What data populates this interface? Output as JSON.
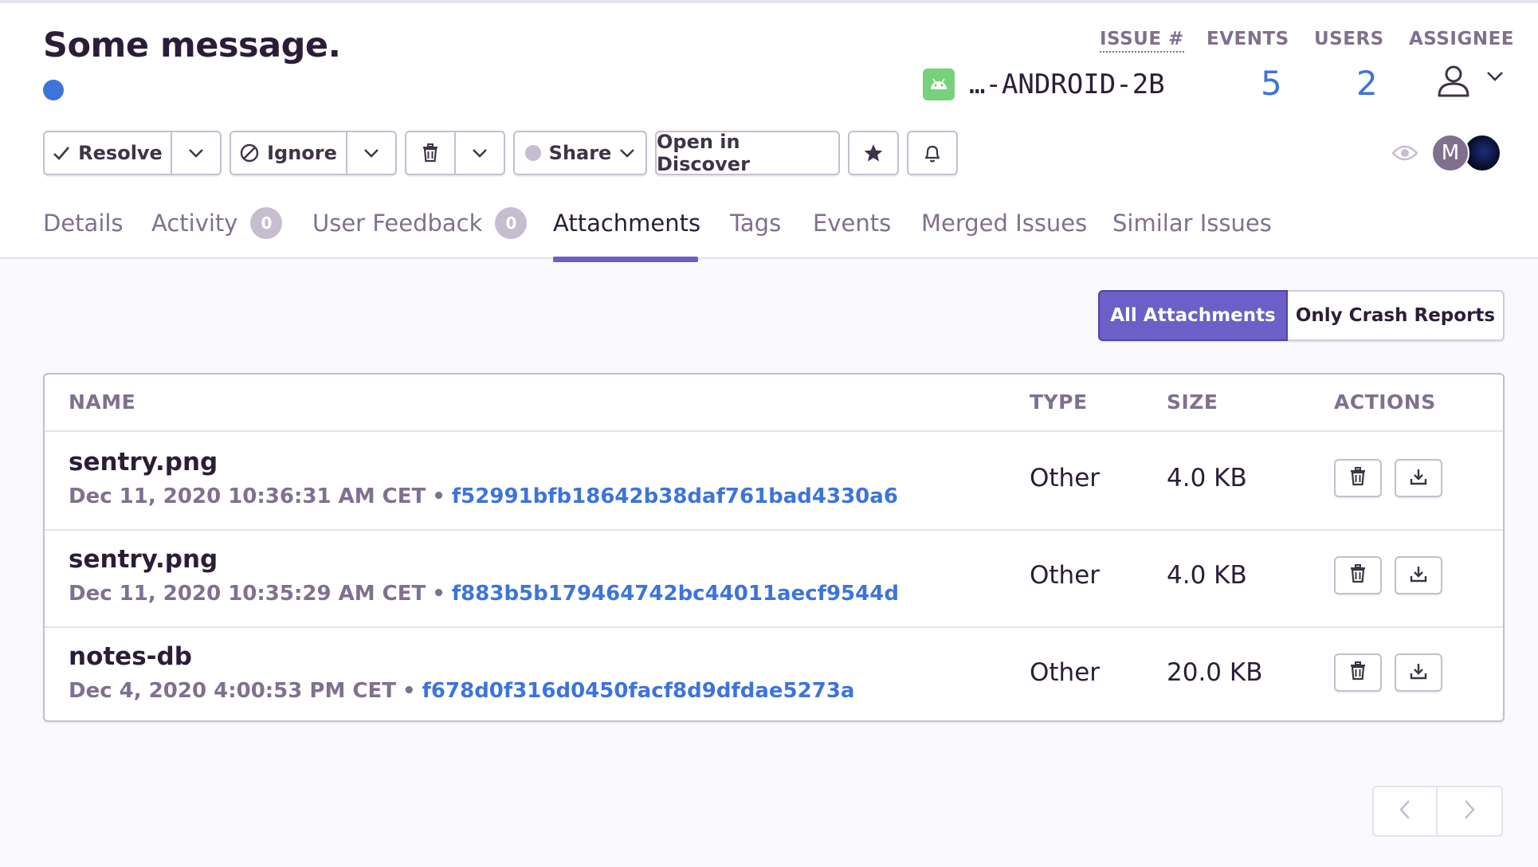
{
  "issue": {
    "title": "Some message.",
    "status_dot_color": "#3D74DB",
    "platform_icon": "android-icon",
    "short_id": "…-ANDROID-2B"
  },
  "stats": {
    "issue_label": "ISSUE #",
    "events_label": "EVENTS",
    "users_label": "USERS",
    "assignee_label": "ASSIGNEE",
    "events_count": "5",
    "users_count": "2"
  },
  "toolbar": {
    "resolve_label": "Resolve",
    "ignore_label": "Ignore",
    "share_label": "Share",
    "discover_label": "Open in Discover"
  },
  "participants": {
    "avatar_initial": "M"
  },
  "tabs": [
    {
      "label": "Details"
    },
    {
      "label": "Activity",
      "badge": "0"
    },
    {
      "label": "User Feedback",
      "badge": "0"
    },
    {
      "label": "Attachments",
      "active": true
    },
    {
      "label": "Tags"
    },
    {
      "label": "Events"
    },
    {
      "label": "Merged Issues"
    },
    {
      "label": "Similar Issues"
    }
  ],
  "filter": {
    "all_label": "All Attachments",
    "crash_label": "Only Crash Reports",
    "selected": "All Attachments"
  },
  "table": {
    "headers": {
      "name": "NAME",
      "type": "TYPE",
      "size": "SIZE",
      "actions": "ACTIONS"
    },
    "rows": [
      {
        "name": "sentry.png",
        "date": "Dec 11, 2020 10:36:31 AM CET",
        "sep": "•",
        "hash": "f52991bfb18642b38daf761bad4330a6",
        "type": "Other",
        "size": "4.0 KB"
      },
      {
        "name": "sentry.png",
        "date": "Dec 11, 2020 10:35:29 AM CET",
        "sep": "•",
        "hash": "f883b5b179464742bc44011aecf9544d",
        "type": "Other",
        "size": "4.0 KB"
      },
      {
        "name": "notes-db",
        "date": "Dec 4, 2020 4:00:53 PM CET",
        "sep": "•",
        "hash": "f678d0f316d0450facf8d9dfdae5273a",
        "type": "Other",
        "size": "20.0 KB"
      }
    ]
  },
  "colors": {
    "accent": "#6C5FC7",
    "link": "#3D74DB",
    "muted": "#80708F",
    "text": "#2B1D38"
  }
}
